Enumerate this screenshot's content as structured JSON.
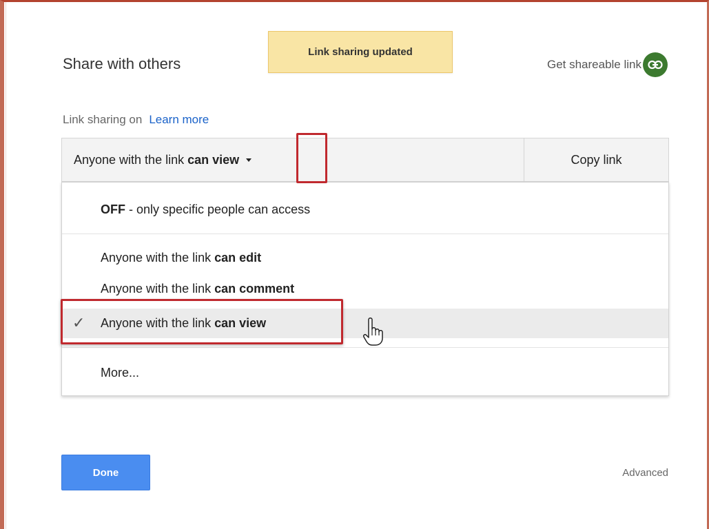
{
  "dialog": {
    "title": "Share with others",
    "toast": "Link sharing updated",
    "get_link_label": "Get shareable link"
  },
  "sharing": {
    "status": "Link sharing on",
    "learn_more": "Learn more",
    "dropdown": {
      "prefix": "Anyone with the link",
      "bold": "can view"
    },
    "copy_link": "Copy link"
  },
  "menu": {
    "off": {
      "bold": "OFF",
      "rest": "- only specific people can access"
    },
    "options": [
      {
        "prefix": "Anyone with the link",
        "bold": "can edit"
      },
      {
        "prefix": "Anyone with the link",
        "bold": "can comment"
      },
      {
        "prefix": "Anyone with the link",
        "bold": "can view",
        "selected": true
      }
    ],
    "check": "✓",
    "more": "More..."
  },
  "footer": {
    "done": "Done",
    "advanced": "Advanced"
  },
  "colors": {
    "accent": "#4a8df0",
    "highlight": "#c0292e",
    "link_icon_bg": "#3c7a2f",
    "toast_bg": "#f9e5a5"
  }
}
